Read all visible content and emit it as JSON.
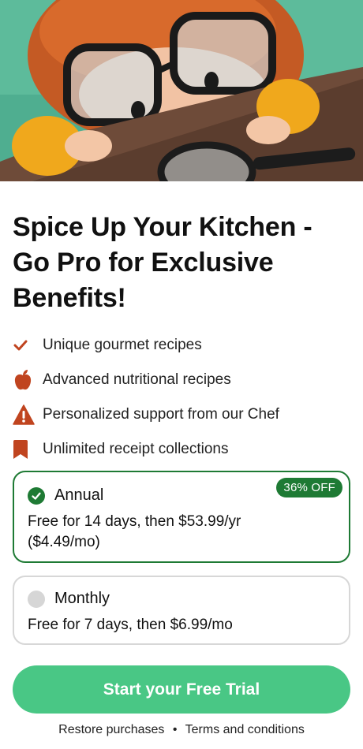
{
  "hero": {
    "alt": "Illustrated child with glasses peeking over a kitchen table"
  },
  "title": "Spice Up Your Kitchen - Go Pro for Exclusive Benefits!",
  "features": [
    {
      "icon": "checkmark-icon",
      "label": "Unique gourmet recipes"
    },
    {
      "icon": "apple-icon",
      "label": "Advanced nutritional recipes"
    },
    {
      "icon": "warning-icon",
      "label": "Personalized support from our Chef"
    },
    {
      "icon": "bookmark-icon",
      "label": "Unlimited receipt collections"
    }
  ],
  "plans": {
    "annual": {
      "name": "Annual",
      "description": "Free for 14 days, then $53.99/yr ($4.49/mo)",
      "badge": "36% OFF",
      "selected": true
    },
    "monthly": {
      "name": "Monthly",
      "description": "Free for 7 days, then $6.99/mo",
      "selected": false
    }
  },
  "cta_label": "Start your Free Trial",
  "footer": {
    "restore": "Restore purchases",
    "separator": "•",
    "terms": "Terms and conditions"
  },
  "colors": {
    "accent_icon": "#c0441f",
    "selected_green": "#1e7a34",
    "cta_green": "#49c785"
  }
}
